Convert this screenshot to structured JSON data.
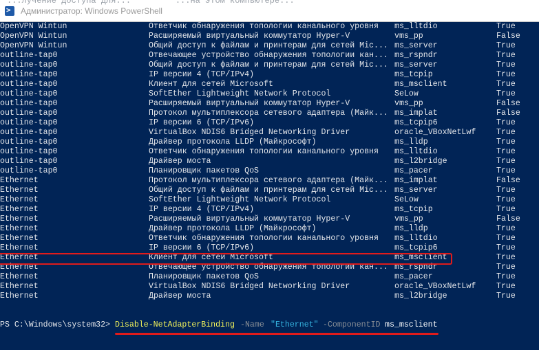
{
  "window": {
    "title": "Администратор: Windows PowerShell",
    "scrolled_top_text": "...лучение доступа для...         ...на этом компьютере...",
    "icon": "powershell-icon"
  },
  "rows": [
    {
      "name": "OpenVPN Wintun",
      "display": "Ответчик обнаружения топологии канального уровня",
      "component": "ms_lltdio",
      "enabled": "True"
    },
    {
      "name": "OpenVPN Wintun",
      "display": "Расширяемый виртуальный коммутатор Hyper-V",
      "component": "vms_pp",
      "enabled": "False"
    },
    {
      "name": "OpenVPN Wintun",
      "display": "Общий доступ к файлам и принтерам для сетей Mic...",
      "component": "ms_server",
      "enabled": "True"
    },
    {
      "name": "outline-tap0",
      "display": "Отвечающее устройство обнаружения топологии кан...",
      "component": "ms_rspndr",
      "enabled": "True"
    },
    {
      "name": "outline-tap0",
      "display": "Общий доступ к файлам и принтерам для сетей Mic...",
      "component": "ms_server",
      "enabled": "True"
    },
    {
      "name": "outline-tap0",
      "display": "IP версии 4 (TCP/IPv4)",
      "component": "ms_tcpip",
      "enabled": "True"
    },
    {
      "name": "outline-tap0",
      "display": "Клиент для сетей Microsoft",
      "component": "ms_msclient",
      "enabled": "True"
    },
    {
      "name": "outline-tap0",
      "display": "SoftEther Lightweight Network Protocol",
      "component": "SeLow",
      "enabled": "True"
    },
    {
      "name": "outline-tap0",
      "display": "Расширяемый виртуальный коммутатор Hyper-V",
      "component": "vms_pp",
      "enabled": "False"
    },
    {
      "name": "outline-tap0",
      "display": "Протокол мультиплексора сетевого адаптера (Майк...",
      "component": "ms_implat",
      "enabled": "False"
    },
    {
      "name": "outline-tap0",
      "display": "IP версии 6 (TCP/IPv6)",
      "component": "ms_tcpip6",
      "enabled": "True"
    },
    {
      "name": "outline-tap0",
      "display": "VirtualBox NDIS6 Bridged Networking Driver",
      "component": "oracle_VBoxNetLwf",
      "enabled": "True"
    },
    {
      "name": "outline-tap0",
      "display": "Драйвер протокола LLDP (Майкрософт)",
      "component": "ms_lldp",
      "enabled": "True"
    },
    {
      "name": "outline-tap0",
      "display": "Ответчик обнаружения топологии канального уровня",
      "component": "ms_lltdio",
      "enabled": "True"
    },
    {
      "name": "outline-tap0",
      "display": "Драйвер моста",
      "component": "ms_l2bridge",
      "enabled": "True"
    },
    {
      "name": "outline-tap0",
      "display": "Планировщик пакетов QoS",
      "component": "ms_pacer",
      "enabled": "True"
    },
    {
      "name": "Ethernet",
      "display": "Протокол мультиплексора сетевого адаптера (Майк...",
      "component": "ms_implat",
      "enabled": "False"
    },
    {
      "name": "Ethernet",
      "display": "Общий доступ к файлам и принтерам для сетей Mic...",
      "component": "ms_server",
      "enabled": "True"
    },
    {
      "name": "Ethernet",
      "display": "SoftEther Lightweight Network Protocol",
      "component": "SeLow",
      "enabled": "True"
    },
    {
      "name": "Ethernet",
      "display": "IP версии 4 (TCP/IPv4)",
      "component": "ms_tcpip",
      "enabled": "True"
    },
    {
      "name": "Ethernet",
      "display": "Расширяемый виртуальный коммутатор Hyper-V",
      "component": "vms_pp",
      "enabled": "False"
    },
    {
      "name": "Ethernet",
      "display": "Драйвер протокола LLDP (Майкрософт)",
      "component": "ms_lldp",
      "enabled": "True"
    },
    {
      "name": "Ethernet",
      "display": "Ответчик обнаружения топологии канального уровня",
      "component": "ms_lltdio",
      "enabled": "True"
    },
    {
      "name": "Ethernet",
      "display": "IP версии 6 (TCP/IPv6)",
      "component": "ms_tcpip6",
      "enabled": "True"
    },
    {
      "name": "Ethernet",
      "display": "Клиент для сетей Microsoft",
      "component": "ms_msclient",
      "enabled": "True"
    },
    {
      "name": "Ethernet",
      "display": "Отвечающее устройство обнаружения топологии кан...",
      "component": "ms_rspndr",
      "enabled": "True"
    },
    {
      "name": "Ethernet",
      "display": "Планировщик пакетов QoS",
      "component": "ms_pacer",
      "enabled": "True"
    },
    {
      "name": "Ethernet",
      "display": "VirtualBox NDIS6 Bridged Networking Driver",
      "component": "oracle_VBoxNetLwf",
      "enabled": "True"
    },
    {
      "name": "Ethernet",
      "display": "Драйвер моста",
      "component": "ms_l2bridge",
      "enabled": "True"
    }
  ],
  "command": {
    "prompt": "PS C:\\Windows\\system32>",
    "cmdlet": "Disable-NetAdapterBinding",
    "param1": "-Name",
    "value1": "\"Ethernet\"",
    "param2": "-ComponentID",
    "value2": "ms_msclient"
  },
  "colors": {
    "background": "#012456",
    "text": "#e4e6ea",
    "cmdlet": "#f3f35a",
    "parameter": "#8a8f96",
    "string": "#35b4e0",
    "annotation": "#e11b1b"
  }
}
